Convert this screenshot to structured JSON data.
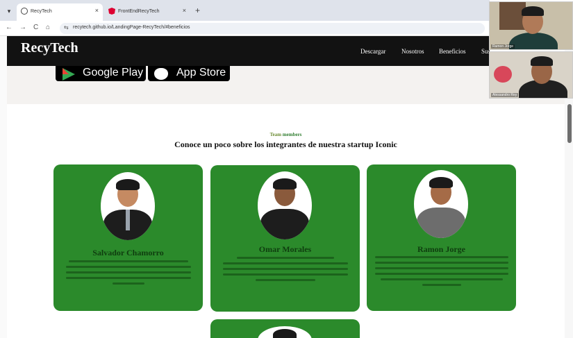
{
  "browser": {
    "tabs": [
      {
        "title": "RecyTech",
        "active": true,
        "icon": "globe-icon"
      },
      {
        "title": "FrontEndRecyTech",
        "active": false,
        "icon": "angular-icon"
      }
    ],
    "tab_close_glyph": "×",
    "new_tab_glyph": "+",
    "tab_list_glyph": "▾",
    "nav": {
      "back": "←",
      "forward": "→",
      "reload": "C",
      "home": "⌂"
    },
    "site_info_glyph": "⇆",
    "url": "recytech.github.io/LandingPage-RecyTech/#beneficios"
  },
  "site": {
    "brand": "RecyTech",
    "nav_links": [
      "Descargar",
      "Nosotros",
      "Beneficios",
      "Suscri"
    ],
    "store_buttons": {
      "google_play": "Google Play",
      "app_store": "App Store"
    },
    "team": {
      "eyebrow_prefix": "Team",
      "eyebrow_accent": "members",
      "title": "Conoce un poco sobre los integrantes de nuestra startup Iconic",
      "members": [
        {
          "name": "Salvador Chamorro"
        },
        {
          "name": "Omar Morales"
        },
        {
          "name": "Ramon Jorge"
        }
      ]
    }
  },
  "video_call": {
    "participants": [
      {
        "name": "Ramon Jorge"
      },
      {
        "name": "Alessandro Rey"
      }
    ]
  },
  "colors": {
    "card_green": "#2b8a2b",
    "nav_black": "#121212",
    "accent_green": "#2f7d2f"
  }
}
